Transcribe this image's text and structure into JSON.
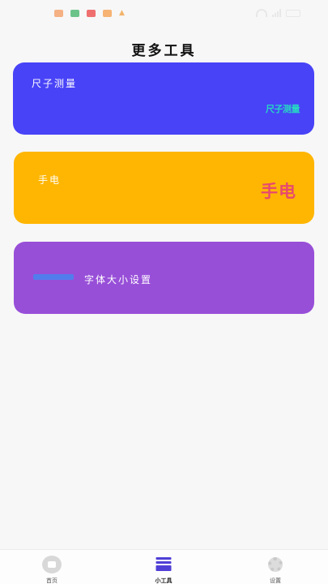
{
  "status_bar": {
    "time": "",
    "notification_icons": [
      "notification-icon-1",
      "notification-icon-2",
      "notification-icon-3",
      "notification-icon-4",
      "notification-icon-5"
    ],
    "icons": [
      "wifi-icon",
      "signal-icon",
      "battery-icon"
    ]
  },
  "header": {
    "title": "更多工具"
  },
  "cards": {
    "ruler": {
      "label": "尺子测量",
      "art_text": "尺子测量",
      "color": "#4843f7",
      "art_color": "#27d6c4"
    },
    "flashlight": {
      "label": "手电",
      "art_text": "手电",
      "color": "#ffb602",
      "art_color": "#e64a6f"
    },
    "font_size": {
      "label": "字体大小设置",
      "color": "#984fd8",
      "art_color": "#4a82ef"
    }
  },
  "tab_bar": {
    "tabs": [
      {
        "label": "首页",
        "icon": "home-icon",
        "active": false
      },
      {
        "label": "小工具",
        "icon": "tools-icon",
        "active": true
      },
      {
        "label": "设置",
        "icon": "gear-icon",
        "active": false
      }
    ]
  }
}
